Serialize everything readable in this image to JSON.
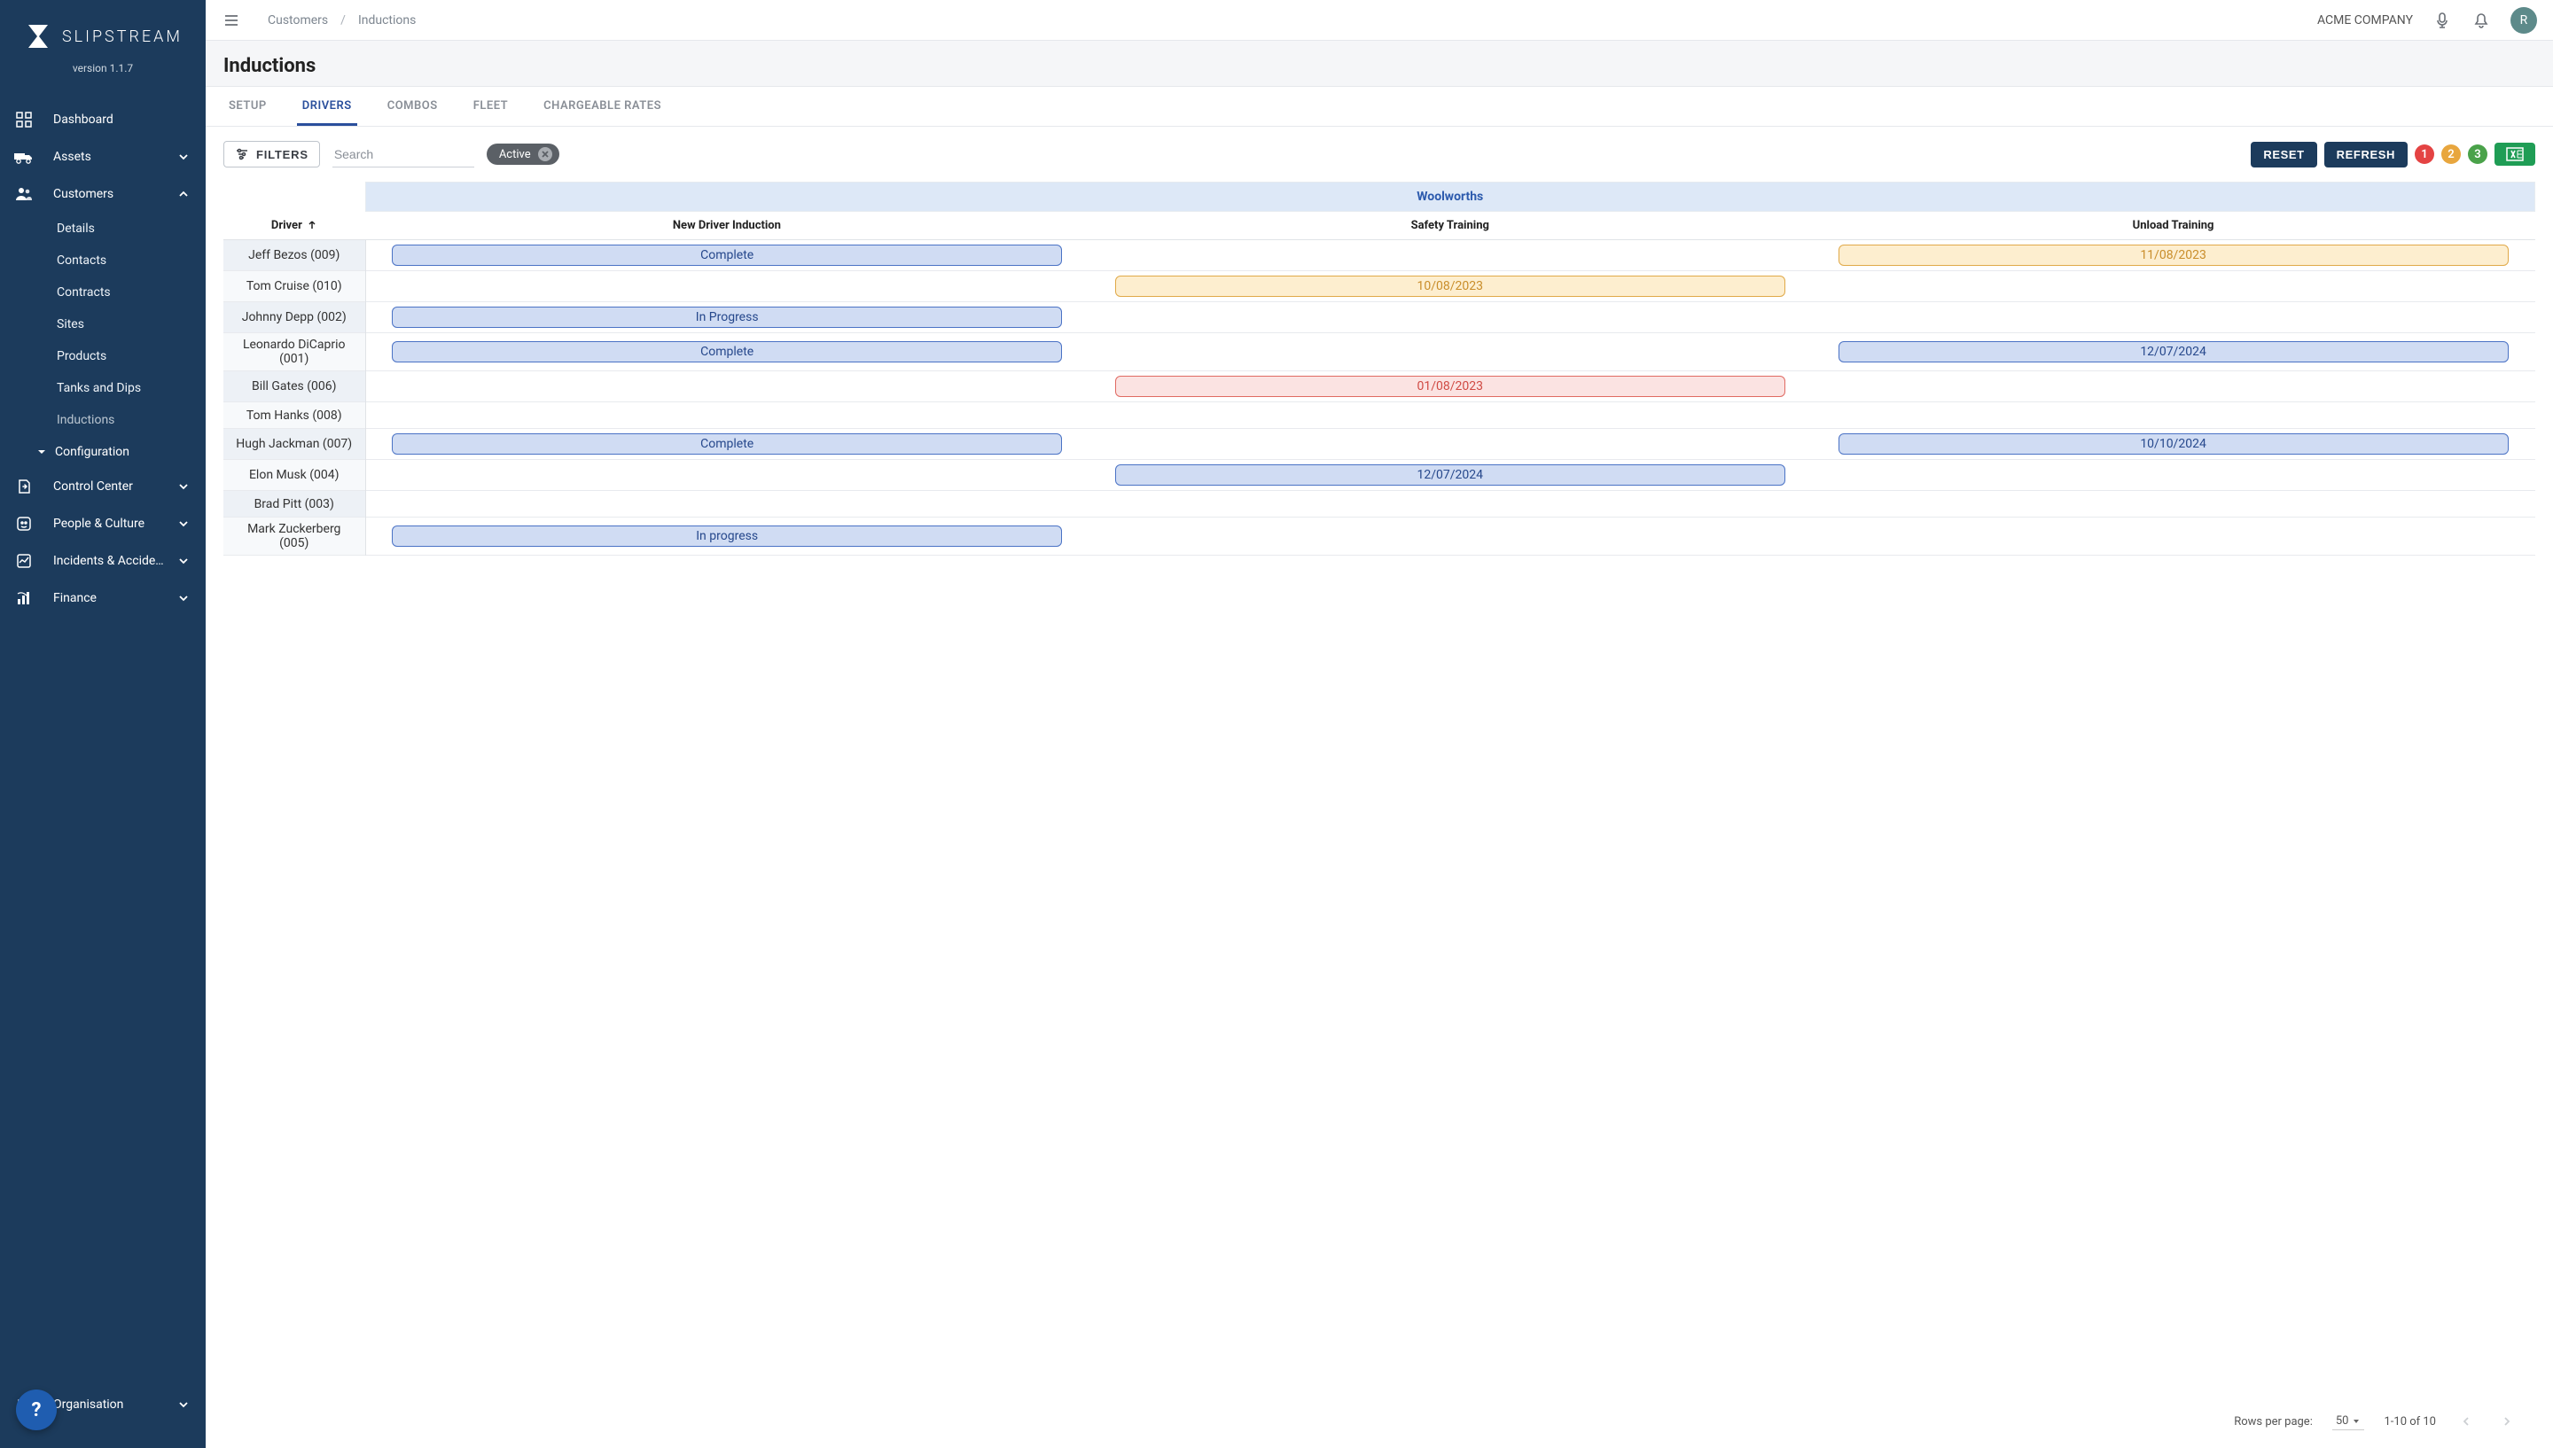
{
  "brand": "SLIPSTREAM",
  "version": "version 1.1.7",
  "sidebar": {
    "items": [
      {
        "label": "Dashboard",
        "icon": "dashboard",
        "expandable": false
      },
      {
        "label": "Assets",
        "icon": "truck",
        "expandable": true,
        "expanded": false
      },
      {
        "label": "Customers",
        "icon": "people",
        "expandable": true,
        "expanded": true,
        "children": [
          {
            "label": "Details"
          },
          {
            "label": "Contacts"
          },
          {
            "label": "Contracts"
          },
          {
            "label": "Sites"
          },
          {
            "label": "Products"
          },
          {
            "label": "Tanks and Dips"
          },
          {
            "label": "Inductions",
            "dim": true
          }
        ]
      },
      {
        "label": "Configuration",
        "type": "config"
      },
      {
        "label": "Control Center",
        "icon": "exitfile",
        "expandable": true
      },
      {
        "label": "People & Culture",
        "icon": "face",
        "expandable": true
      },
      {
        "label": "Incidents & Accide…",
        "icon": "chart",
        "expandable": true
      },
      {
        "label": "Finance",
        "icon": "stats",
        "expandable": true
      }
    ],
    "bottom": {
      "label": "Organisation",
      "icon": "org",
      "expandable": true
    }
  },
  "breadcrumbs": [
    "Customers",
    "Inductions"
  ],
  "company": "ACME COMPANY",
  "avatar_letter": "R",
  "page_title": "Inductions",
  "tabs": [
    "SETUP",
    "DRIVERS",
    "COMBOS",
    "FLEET",
    "CHARGEABLE RATES"
  ],
  "active_tab": "DRIVERS",
  "filters_label": "FILTERS",
  "search_placeholder": "Search",
  "active_chip": "Active",
  "buttons": {
    "reset": "RESET",
    "refresh": "REFRESH"
  },
  "legend": [
    "1",
    "2",
    "3"
  ],
  "group_header": "Woolworths",
  "columns": [
    "Driver",
    "New Driver Induction",
    "Safety Training",
    "Unload Training"
  ],
  "rows": [
    {
      "driver": "Jeff Bezos (009)",
      "new_driver": {
        "text": "Complete",
        "color": "blue"
      },
      "safety": null,
      "unload": {
        "text": "11/08/2023",
        "color": "amber"
      }
    },
    {
      "driver": "Tom Cruise (010)",
      "new_driver": null,
      "safety": {
        "text": "10/08/2023",
        "color": "amber"
      },
      "unload": null
    },
    {
      "driver": "Johnny Depp (002)",
      "new_driver": {
        "text": "In Progress",
        "color": "blue"
      },
      "safety": null,
      "unload": null
    },
    {
      "driver": "Leonardo DiCaprio (001)",
      "new_driver": {
        "text": "Complete",
        "color": "blue"
      },
      "safety": null,
      "unload": {
        "text": "12/07/2024",
        "color": "blue"
      }
    },
    {
      "driver": "Bill Gates (006)",
      "new_driver": null,
      "safety": {
        "text": "01/08/2023",
        "color": "red"
      },
      "unload": null
    },
    {
      "driver": "Tom Hanks (008)",
      "new_driver": null,
      "safety": null,
      "unload": null
    },
    {
      "driver": "Hugh Jackman (007)",
      "new_driver": {
        "text": "Complete",
        "color": "blue"
      },
      "safety": null,
      "unload": {
        "text": "10/10/2024",
        "color": "blue"
      }
    },
    {
      "driver": "Elon Musk (004)",
      "new_driver": null,
      "safety": {
        "text": "12/07/2024",
        "color": "blue"
      },
      "unload": null
    },
    {
      "driver": "Brad Pitt (003)",
      "new_driver": null,
      "safety": null,
      "unload": null
    },
    {
      "driver": "Mark Zuckerberg (005)",
      "new_driver": {
        "text": "In progress",
        "color": "blue"
      },
      "safety": null,
      "unload": null
    }
  ],
  "footer": {
    "rows_label": "Rows per page:",
    "rows_value": "50",
    "range": "1-10 of 10"
  },
  "help": "?"
}
